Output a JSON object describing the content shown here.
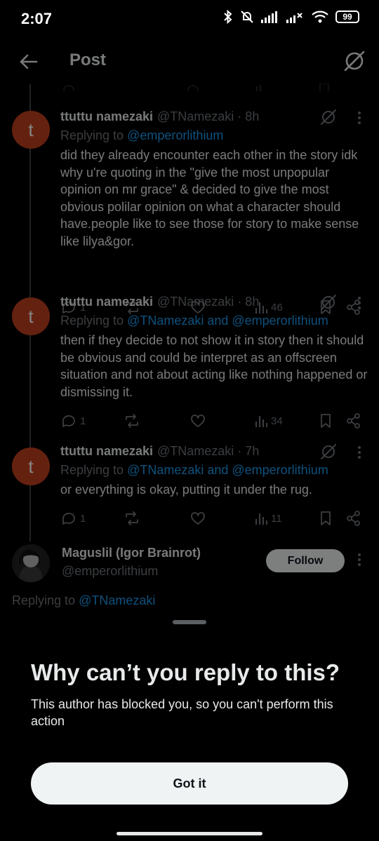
{
  "status_bar": {
    "time": "2:07",
    "battery": "99",
    "icons": [
      "bluetooth-icon",
      "bell-muted-icon",
      "signal-icon",
      "signal-x-icon",
      "wifi-icon",
      "battery-icon"
    ]
  },
  "header": {
    "title": "Post",
    "icons": [
      "back-arrow-icon",
      "grok-icon"
    ]
  },
  "tweets": [
    {
      "name": "ttuttu namezaki",
      "handle": "@TNamezaki · 8h",
      "avatar_letter": "t",
      "replying_prefix": "Replying to ",
      "replying_to": "@emperorlithium",
      "text": "did they already encounter each other in the story idk why u're quoting in the \"give the most unpopular opinion on mr grace\" & decided to give the most obvious polilar opinion on what a character should have.people like to see those for story to make sense  like lilya&gor.",
      "replies": "1",
      "views": "46"
    },
    {
      "name": "ttuttu namezaki",
      "handle": "@TNamezaki · 8h",
      "avatar_letter": "t",
      "replying_prefix": "Replying to ",
      "replying_to": "@TNamezaki and @emperorlithium",
      "text": "then if they decide to not show it in story then it should be obvious and could be interpret as an offscreen situation and not about acting like nothing happened or dismissing it.",
      "replies": "1",
      "views": "34"
    },
    {
      "name": "ttuttu namezaki",
      "handle": "@TNamezaki · 7h",
      "avatar_letter": "t",
      "replying_prefix": "Replying to ",
      "replying_to": "@TNamezaki and @emperorlithium",
      "text": "or everything is okay, putting it under the rug.",
      "replies": "1",
      "views": "11"
    }
  ],
  "profile": {
    "name": "Maguslil (Igor Brainrot)",
    "handle": "@emperorlithium",
    "follow_label": "Follow",
    "replying_prefix": "Replying to ",
    "replying_to": "@TNamezaki"
  },
  "sheet": {
    "title": "Why can’t you reply to this?",
    "body": "This author has blocked you, so you can't perform this action",
    "button_label": "Got it"
  },
  "colors": {
    "background": "#000000",
    "text": "#e7e9ea",
    "muted": "#71767b",
    "link": "#1d9bf0",
    "avatar": "#c2401f",
    "button_bg": "#eff3f4"
  }
}
